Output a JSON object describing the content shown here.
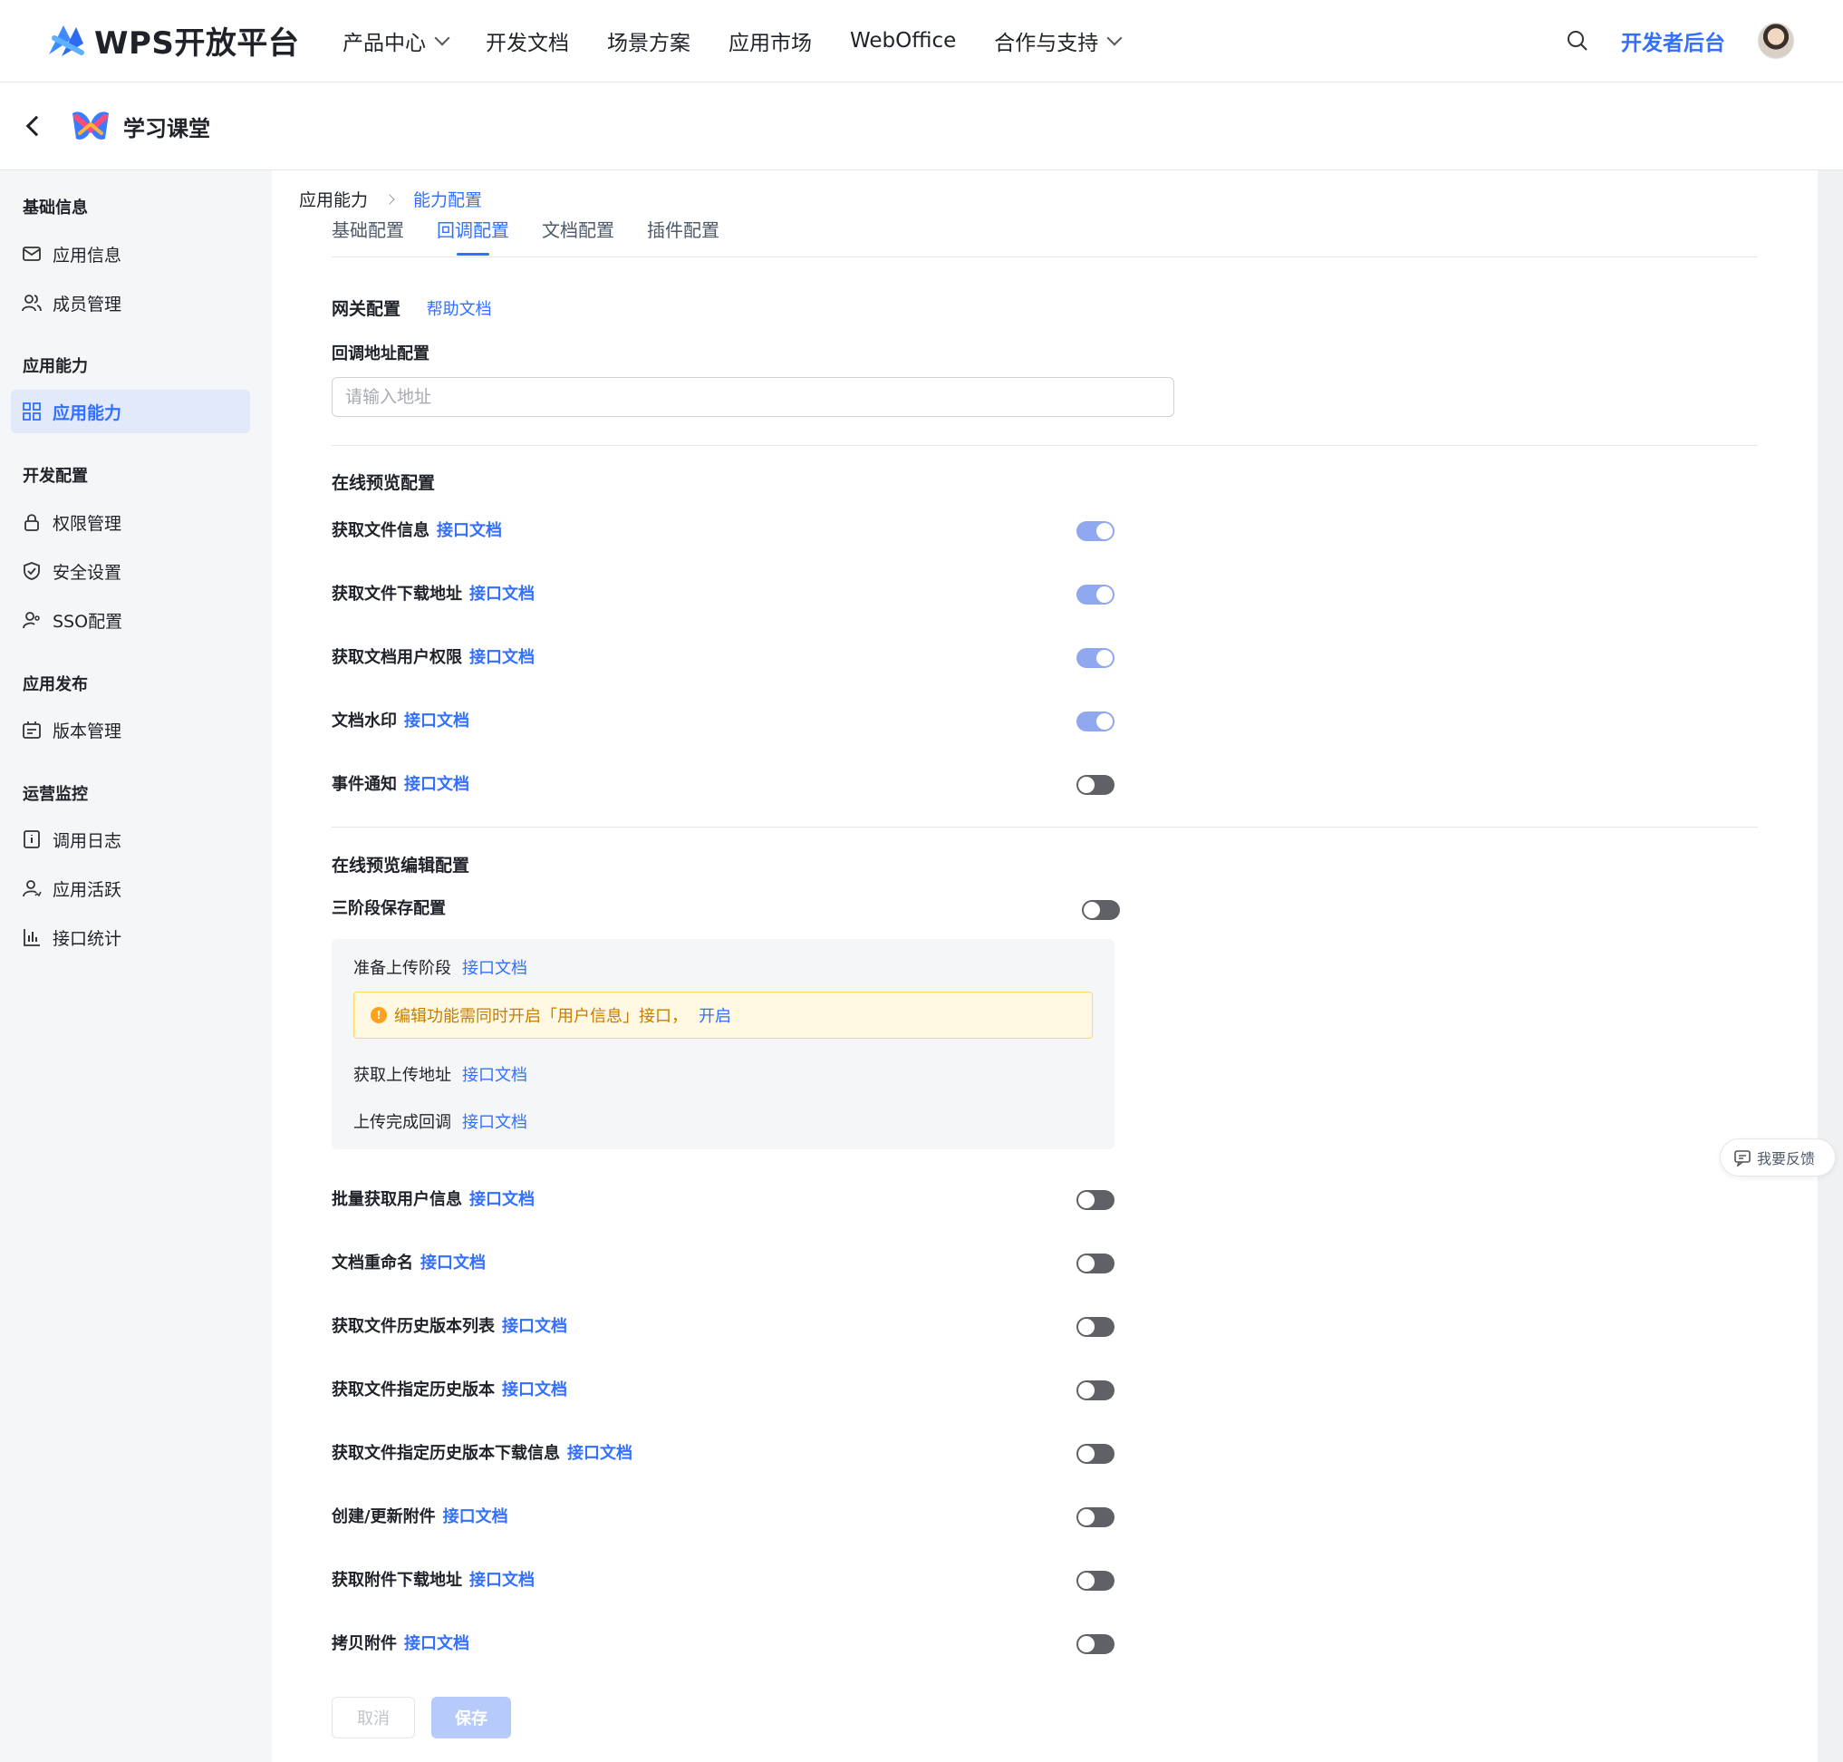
{
  "header": {
    "logo_text": "WPS开放平台",
    "nav": [
      "产品中心",
      "开发文档",
      "场景方案",
      "应用市场",
      "WebOffice",
      "合作与支持"
    ],
    "developer_link": "开发者后台"
  },
  "app": {
    "name": "学习课堂"
  },
  "sidebar": {
    "groups": [
      {
        "title": "基础信息",
        "items": [
          {
            "label": "应用信息",
            "icon": "mail-icon"
          },
          {
            "label": "成员管理",
            "icon": "users-icon"
          }
        ]
      },
      {
        "title": "应用能力",
        "items": [
          {
            "label": "应用能力",
            "icon": "grid-icon",
            "active": true
          }
        ]
      },
      {
        "title": "开发配置",
        "items": [
          {
            "label": "权限管理",
            "icon": "lock-icon"
          },
          {
            "label": "安全设置",
            "icon": "shield-icon"
          },
          {
            "label": "SSO配置",
            "icon": "user-key-icon"
          }
        ]
      },
      {
        "title": "应用发布",
        "items": [
          {
            "label": "版本管理",
            "icon": "version-icon"
          }
        ]
      },
      {
        "title": "运营监控",
        "items": [
          {
            "label": "调用日志",
            "icon": "log-icon"
          },
          {
            "label": "应用活跃",
            "icon": "active-user-icon"
          },
          {
            "label": "接口统计",
            "icon": "bar-chart-icon"
          }
        ]
      }
    ]
  },
  "breadcrumb": {
    "parent": "应用能力",
    "current": "能力配置"
  },
  "tabs": [
    {
      "label": "基础配置",
      "active": false
    },
    {
      "label": "回调配置",
      "active": true
    },
    {
      "label": "文档配置",
      "active": false
    },
    {
      "label": "插件配置",
      "active": false
    }
  ],
  "gateway": {
    "title": "网关配置",
    "help_link": "帮助文档",
    "field_label": "回调地址配置",
    "placeholder": "请输入地址",
    "value": ""
  },
  "preview": {
    "title": "在线预览配置",
    "rows": [
      {
        "label": "获取文件信息",
        "link": "接口文档",
        "on": true
      },
      {
        "label": "获取文件下载地址",
        "link": "接口文档",
        "on": true
      },
      {
        "label": "获取文档用户权限",
        "link": "接口文档",
        "on": true
      },
      {
        "label": "文档水印",
        "link": "接口文档",
        "on": true
      },
      {
        "label": "事件通知",
        "link": "接口文档",
        "on": false
      }
    ]
  },
  "edit": {
    "title": "在线预览编辑配置",
    "three_stage": {
      "label": "三阶段保存配置",
      "on": false
    },
    "panel": {
      "prepare": {
        "label": "准备上传阶段",
        "link": "接口文档"
      },
      "warning": {
        "text": "编辑功能需同时开启「用户信息」接口，",
        "link": "开启"
      },
      "get_address": {
        "label": "获取上传地址",
        "link": "接口文档"
      },
      "complete": {
        "label": "上传完成回调",
        "link": "接口文档"
      }
    },
    "rows": [
      {
        "label": "批量获取用户信息",
        "link": "接口文档",
        "on": false
      },
      {
        "label": "文档重命名",
        "link": "接口文档",
        "on": false
      },
      {
        "label": "获取文件历史版本列表",
        "link": "接口文档",
        "on": false
      },
      {
        "label": "获取文件指定历史版本",
        "link": "接口文档",
        "on": false
      },
      {
        "label": "获取文件指定历史版本下载信息",
        "link": "接口文档",
        "on": false
      },
      {
        "label": "创建/更新附件",
        "link": "接口文档",
        "on": false
      },
      {
        "label": "获取附件下载地址",
        "link": "接口文档",
        "on": false
      },
      {
        "label": "拷贝附件",
        "link": "接口文档",
        "on": false
      }
    ]
  },
  "actions": {
    "cancel": "取消",
    "save": "保存"
  },
  "feedback": {
    "label": "我要反馈"
  },
  "colors": {
    "accent": "#3370ff",
    "toggle_on": "#8fa8ef",
    "toggle_off": "#5f6166",
    "warning_bg": "#fff8e3"
  }
}
